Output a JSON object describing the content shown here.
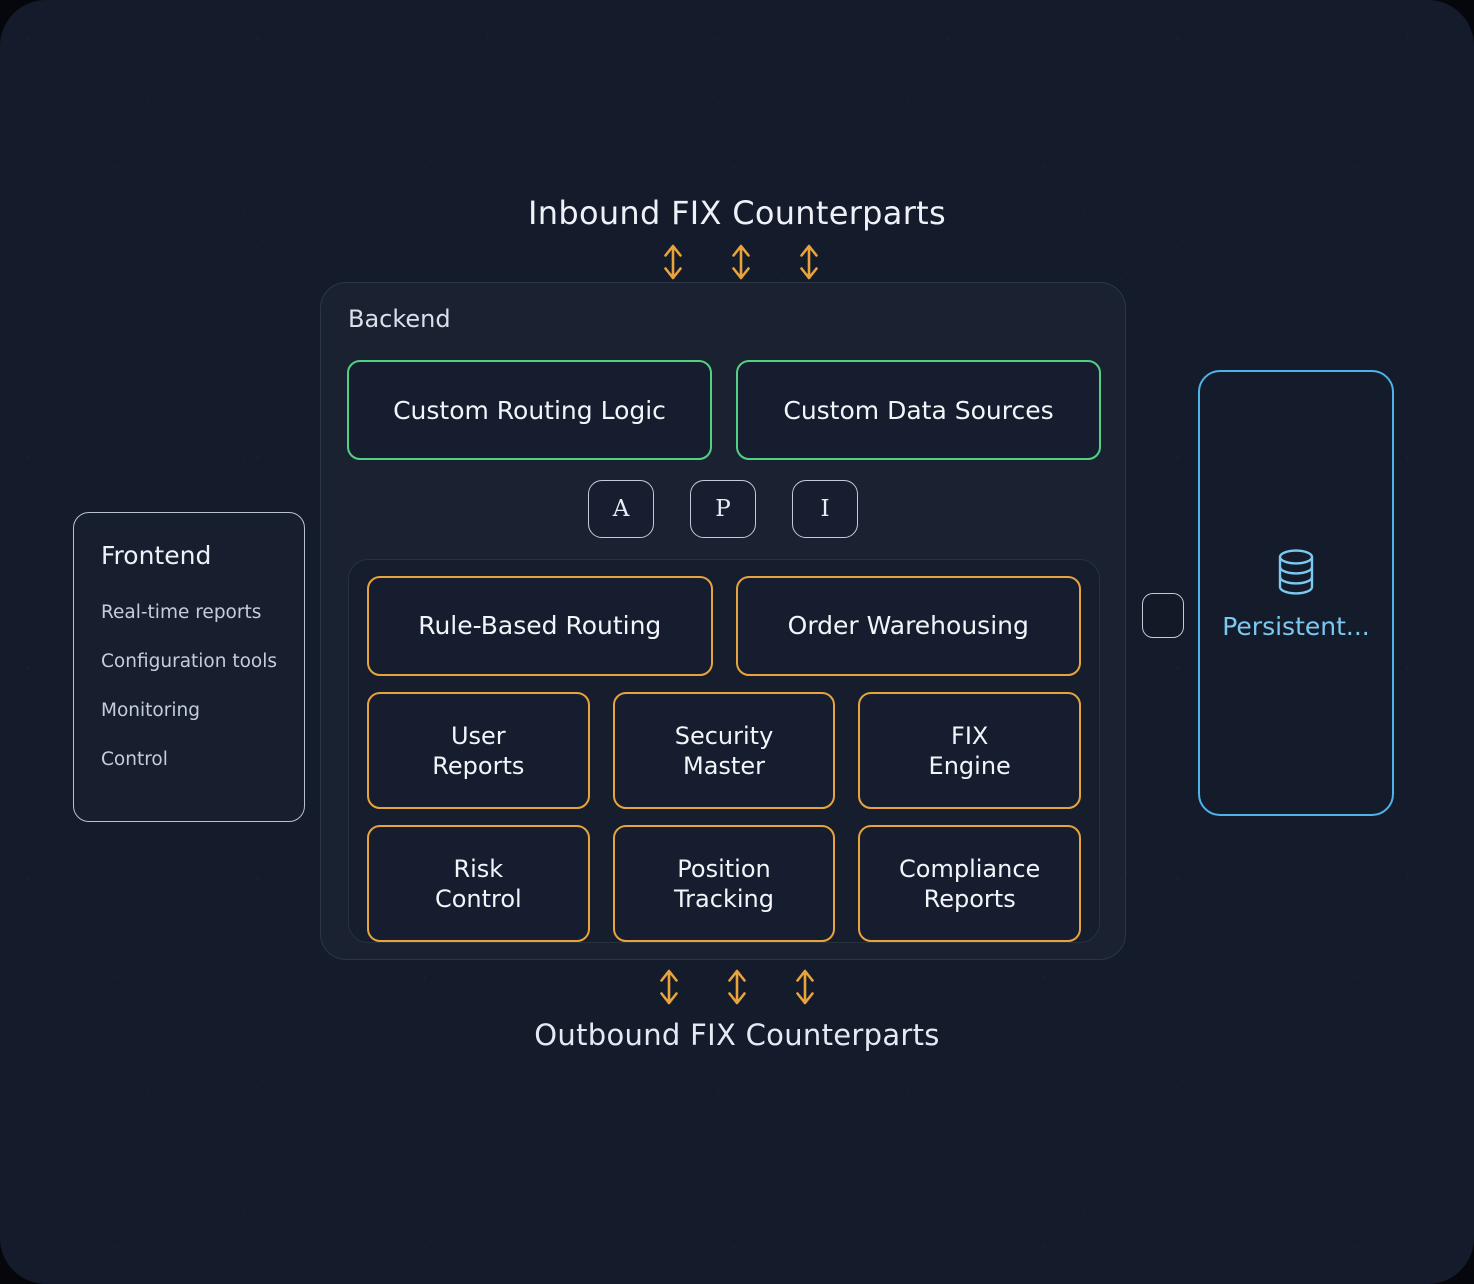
{
  "theme": {
    "background": "#141b2a",
    "panel_bg": "#1a2232",
    "accent_green": "#52d184",
    "accent_orange": "#e8a33d",
    "accent_blue": "#4eb3e8",
    "text_primary": "#f2f5fa",
    "text_muted": "#c5cdda"
  },
  "inbound": {
    "title": "Inbound FIX Counterparts",
    "arrow_icon": "up-down-arrow-icon",
    "arrow_count": 3
  },
  "outbound": {
    "title": "Outbound FIX Counterparts",
    "arrow_icon": "up-down-arrow-icon",
    "arrow_count": 3
  },
  "frontend": {
    "title": "Frontend",
    "items": [
      {
        "label": "Real-time reports"
      },
      {
        "label": "Configuration tools"
      },
      {
        "label": "Monitoring"
      },
      {
        "label": "Control"
      }
    ]
  },
  "backend": {
    "title": "Backend",
    "custom_boxes": [
      {
        "label": "Custom Routing Logic"
      },
      {
        "label": "Custom Data Sources"
      }
    ],
    "api_letters": [
      {
        "label": "A"
      },
      {
        "label": "P"
      },
      {
        "label": "I"
      }
    ],
    "services_primary": [
      {
        "label": "Rule-Based Routing"
      },
      {
        "label": "Order Warehousing"
      }
    ],
    "services_grid": [
      {
        "line1": "User",
        "line2": "Reports"
      },
      {
        "line1": "Security",
        "line2": "Master"
      },
      {
        "line1": "FIX",
        "line2": "Engine"
      },
      {
        "line1": "Risk",
        "line2": "Control"
      },
      {
        "line1": "Position",
        "line2": "Tracking"
      },
      {
        "line1": "Compliance",
        "line2": "Reports"
      }
    ]
  },
  "storage": {
    "label": "Persistent...",
    "icon": "database-icon"
  },
  "connector": {
    "icon": "connector-node-icon"
  }
}
